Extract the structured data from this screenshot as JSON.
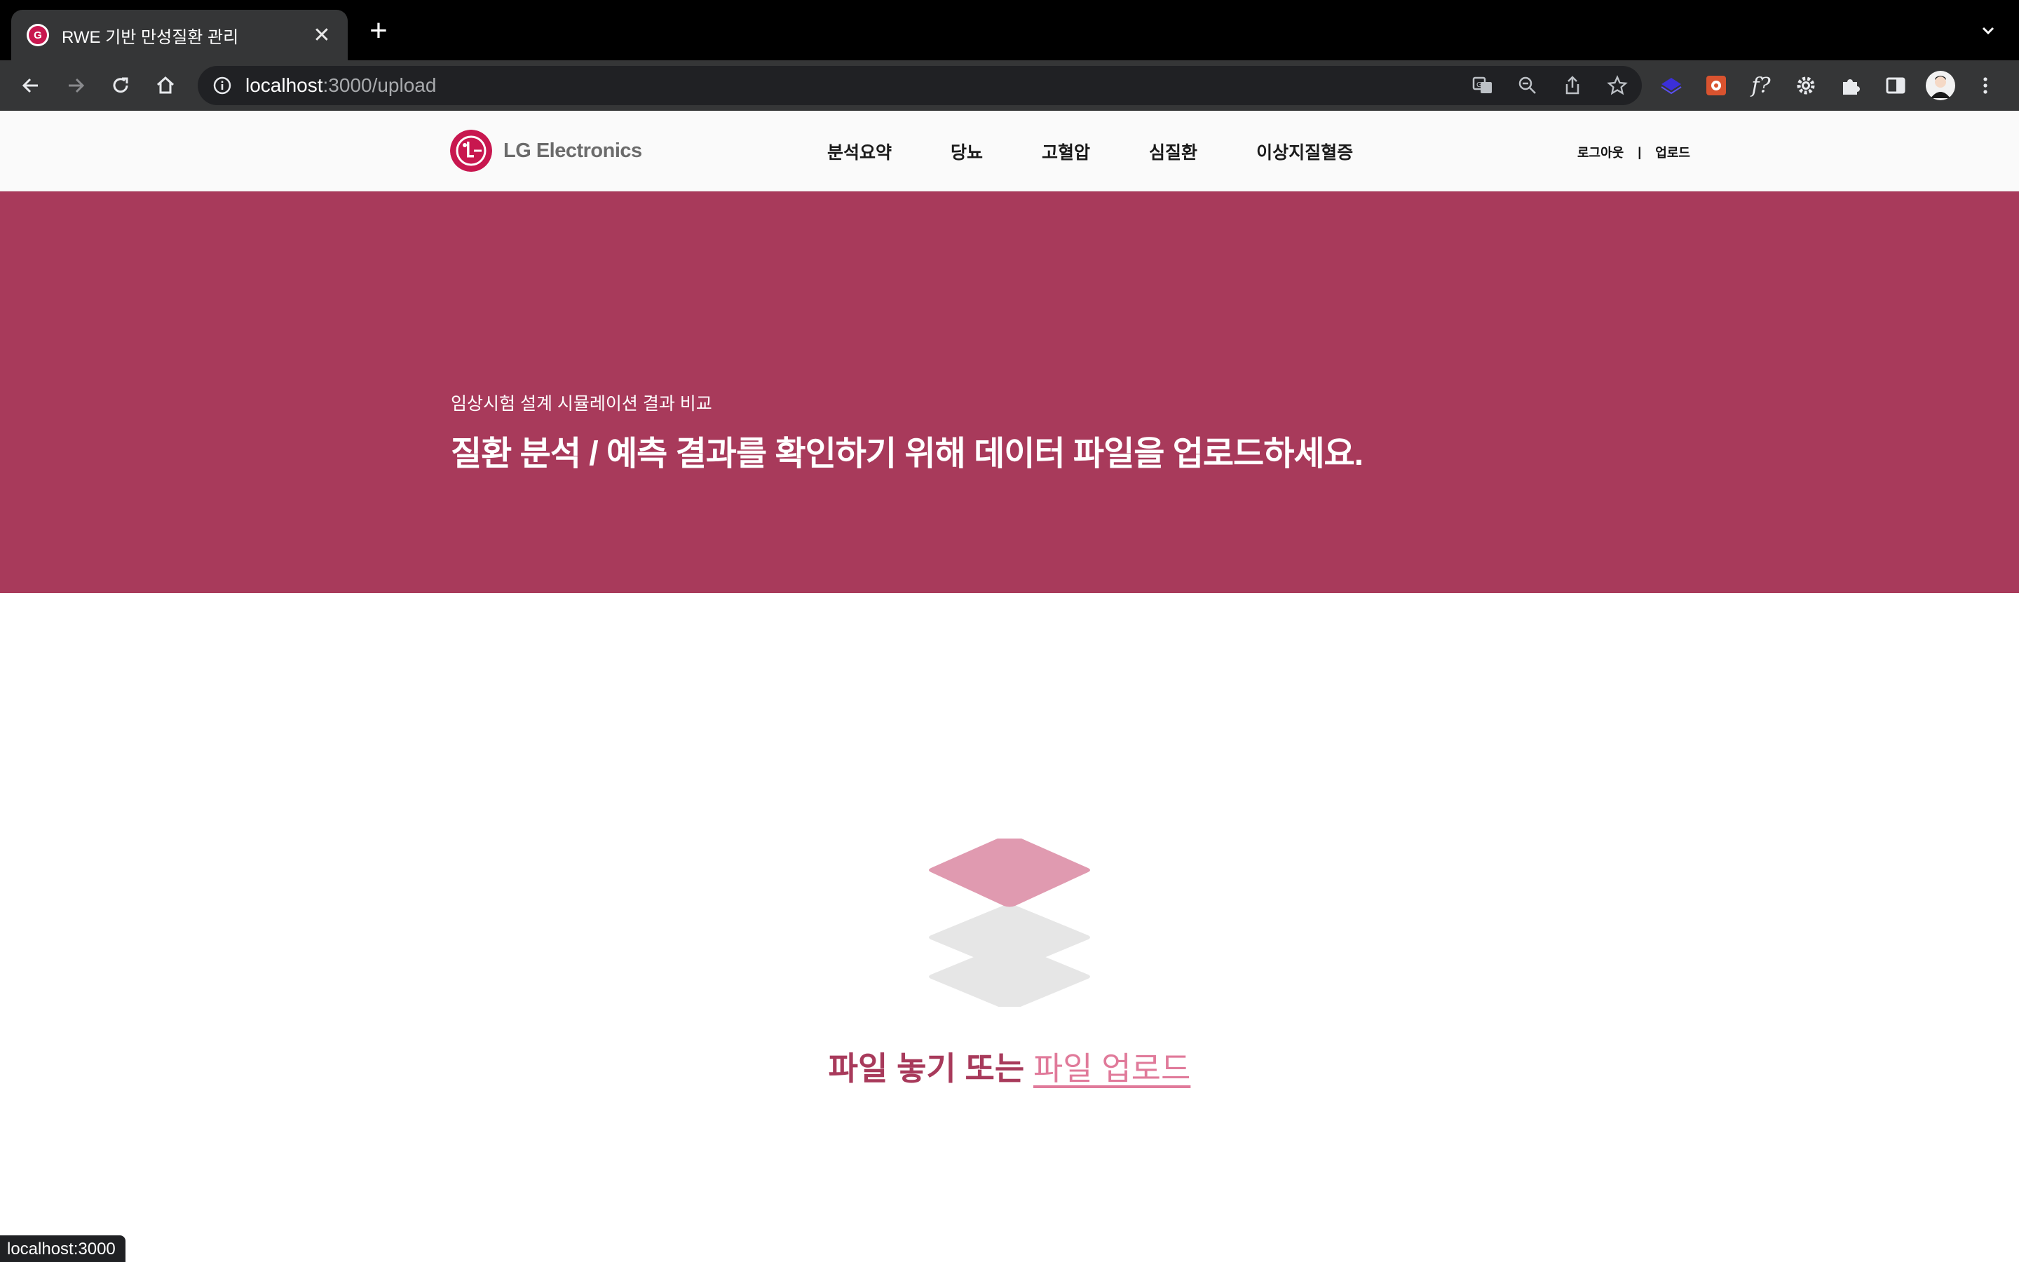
{
  "browser": {
    "tab_title": "RWE 기반 만성질환 관리",
    "url_host": "localhost",
    "url_path": ":3000/upload",
    "status_url": "localhost:3000"
  },
  "header": {
    "logo_text": "LG Electronics",
    "nav": [
      "분석요약",
      "당뇨",
      "고혈압",
      "심질환",
      "이상지질혈증"
    ],
    "logout": "로그아웃",
    "separator": "|",
    "upload": "업로드"
  },
  "hero": {
    "subtitle": "임상시험 설계 시뮬레이션 결과 비교",
    "title": "질환 분석 / 예측 결과를 확인하기 위해 데이터 파일을 업로드하세요."
  },
  "upload": {
    "drop_text": "파일 놓기 또는 ",
    "link_text": "파일 업로드"
  },
  "colors": {
    "brand": "#c8174f",
    "hero_bg": "#a83a5b",
    "accent_pink": "#e07a9a"
  }
}
